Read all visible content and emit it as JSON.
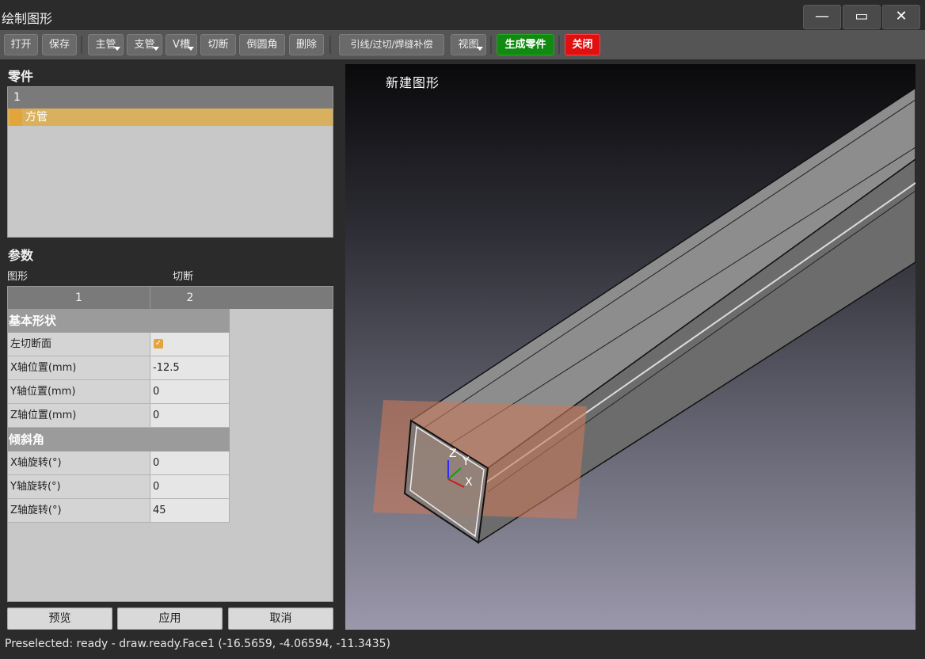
{
  "window": {
    "title": "绘制图形",
    "min_glyph": "—",
    "max_glyph": "▭",
    "close_glyph": "✕"
  },
  "toolbar": {
    "open": "打开",
    "save": "保存",
    "main_pipe": "主管",
    "branch_pipe": "支管",
    "v_groove": "V槽",
    "cut": "切断",
    "fillet": "倒圆角",
    "delete": "删除",
    "lead_weld": "引线/过切/焊缝补偿",
    "view": "视图",
    "generate": "生成零件",
    "close": "关闭"
  },
  "parts": {
    "heading": "零件",
    "header": "1",
    "items": [
      {
        "label": "方管",
        "selected": true
      }
    ]
  },
  "params": {
    "heading": "参数",
    "col_labels": [
      "图形",
      "切断"
    ],
    "tabs": [
      "1",
      "2"
    ],
    "groups": [
      {
        "title": "基本形状",
        "rows": [
          {
            "label": "左切断面",
            "value": "",
            "checkbox": true,
            "checked": true
          },
          {
            "label": "X轴位置(mm)",
            "value": "-12.5"
          },
          {
            "label": "Y轴位置(mm)",
            "value": "0"
          },
          {
            "label": "Z轴位置(mm)",
            "value": "0"
          }
        ]
      },
      {
        "title": "倾斜角",
        "rows": [
          {
            "label": "X轴旋转(°)",
            "value": "0"
          },
          {
            "label": "Y轴旋转(°)",
            "value": "0"
          },
          {
            "label": "Z轴旋转(°)",
            "value": "45"
          }
        ]
      }
    ]
  },
  "buttons": {
    "preview": "预览",
    "apply": "应用",
    "cancel": "取消"
  },
  "viewport": {
    "title": "新建图形",
    "axis_x": "X",
    "axis_y": "Y",
    "axis_z": "Z",
    "cut_plane_color": "#c8795a"
  },
  "status": "Preselected: ready - draw.ready.Face1 (-16.5659, -4.06594, -11.3435)",
  "colors": {
    "accent": "#e3a43c",
    "selection": "#d9b15e",
    "generate_button": "#108a10",
    "close_button": "#e01010"
  }
}
